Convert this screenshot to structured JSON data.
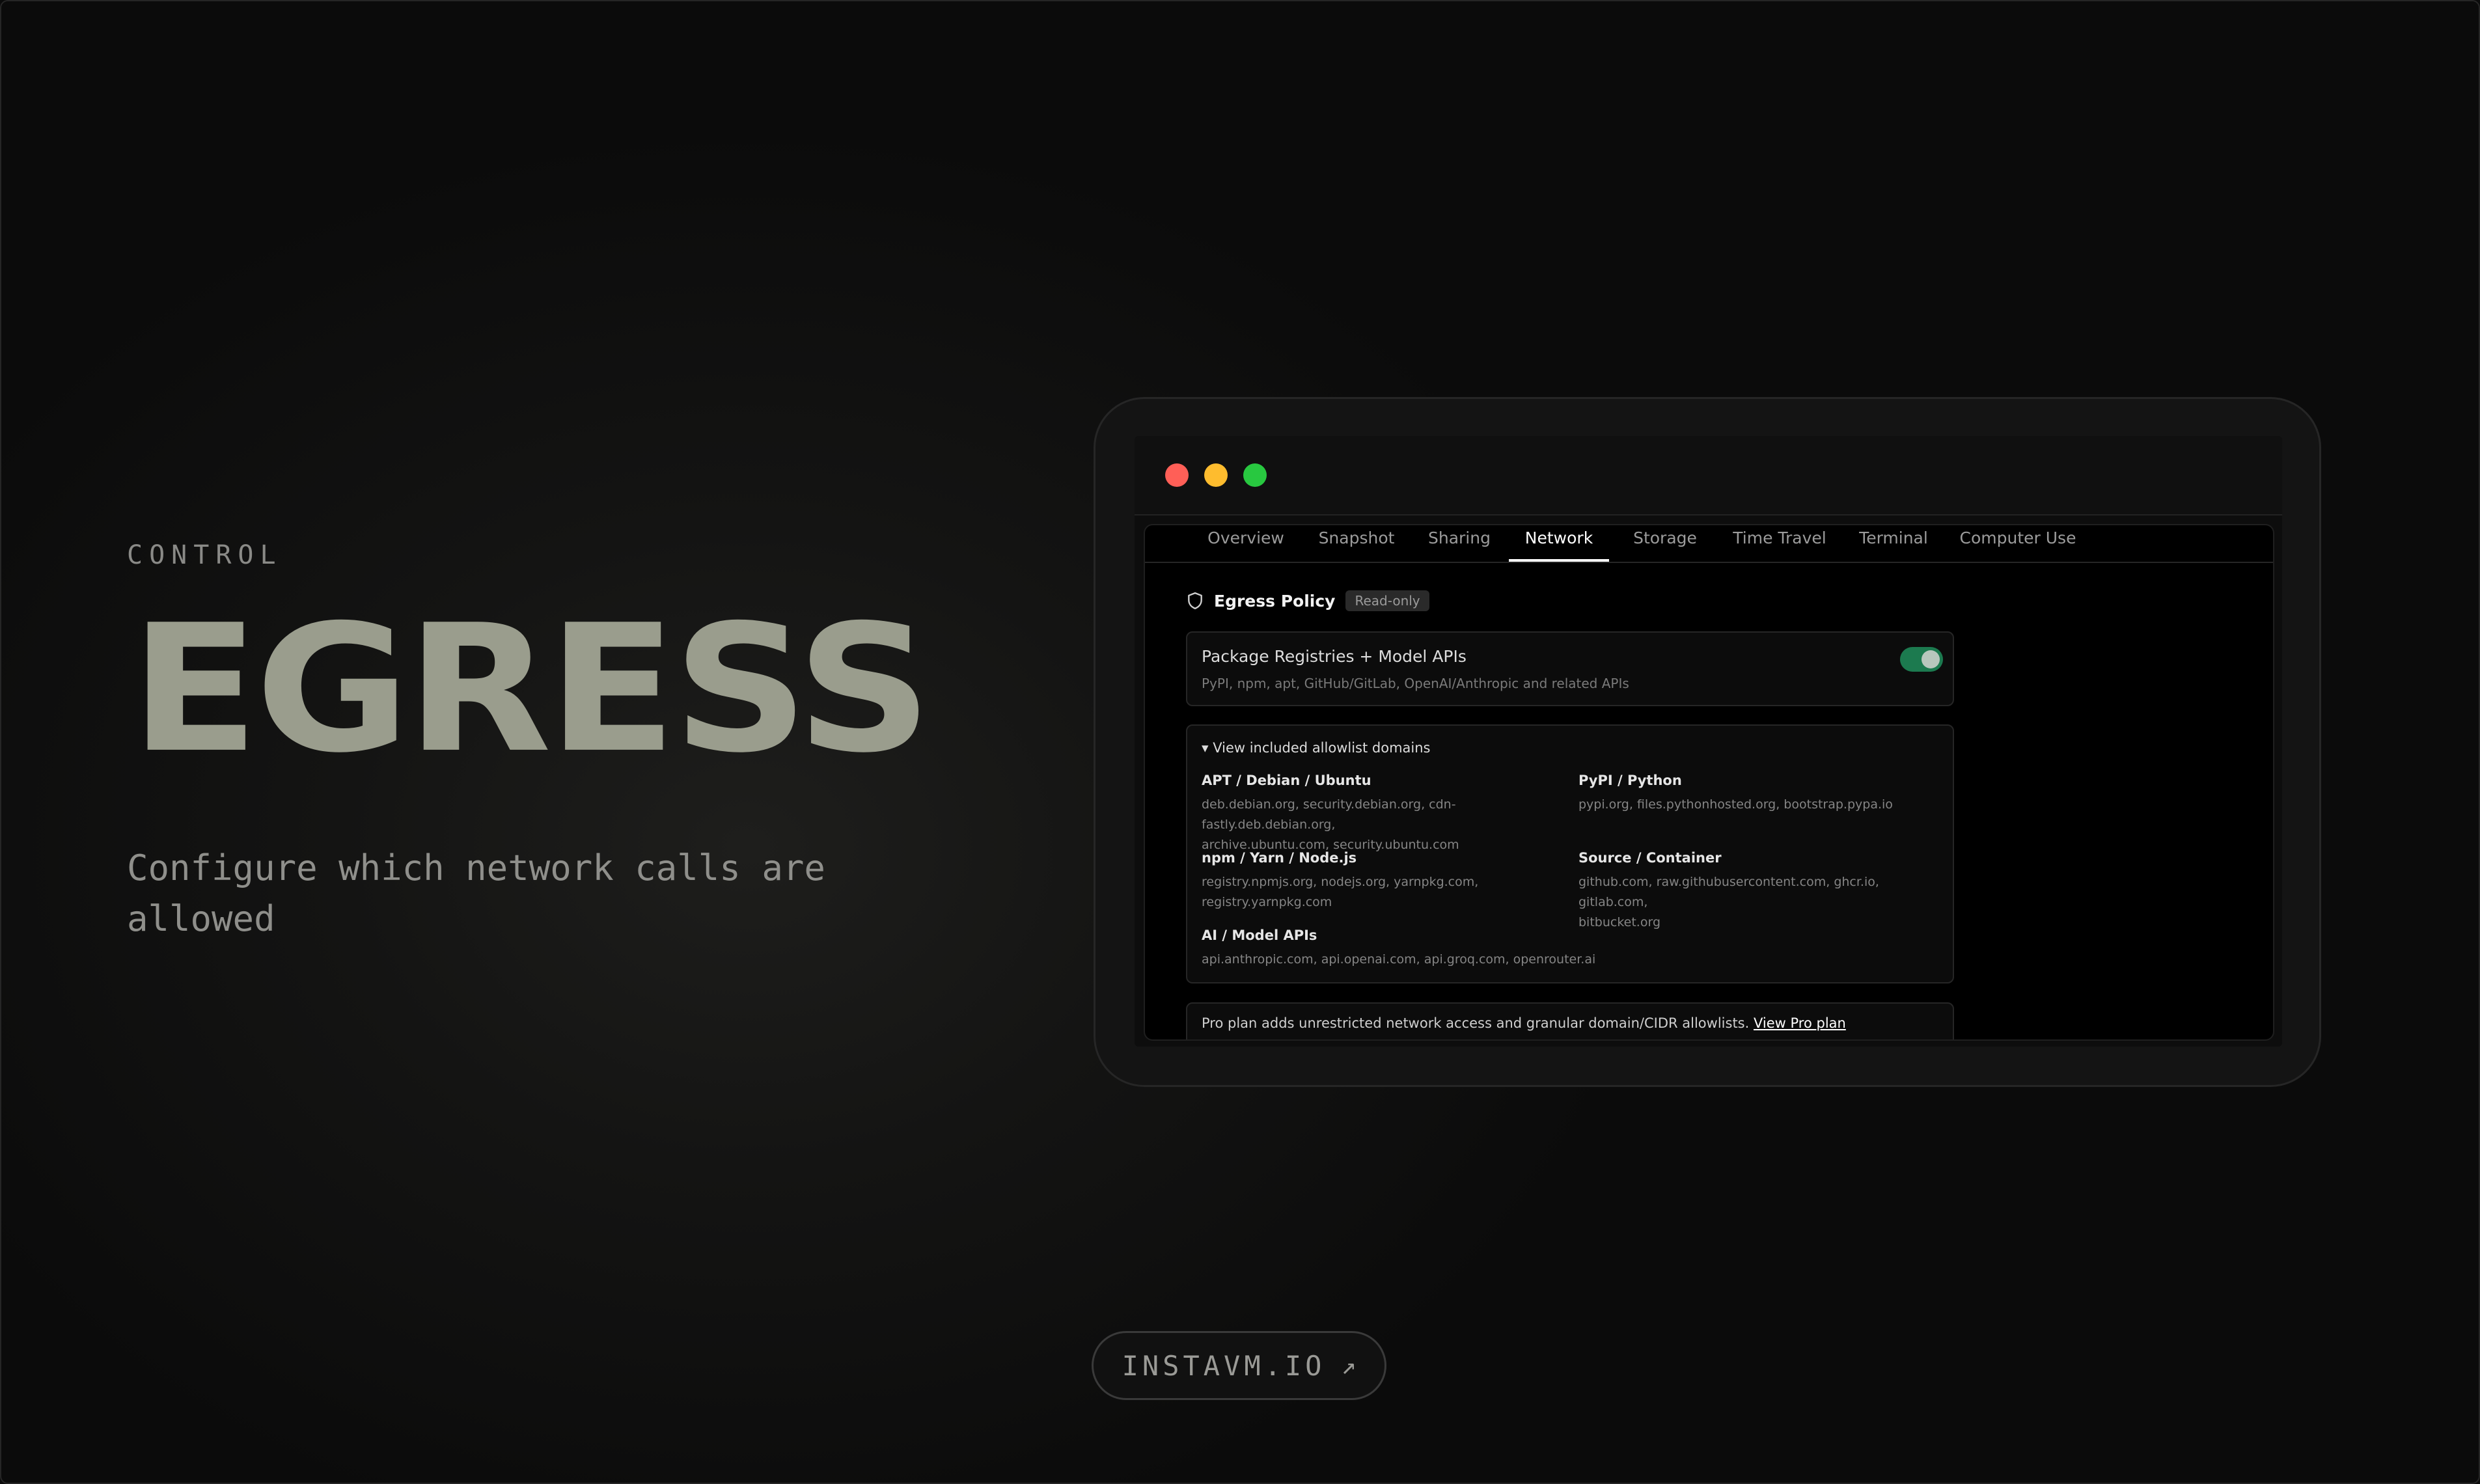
{
  "hero": {
    "eyebrow": "CONTROL",
    "title": "EGRESS",
    "subtitle": "Configure which network calls are allowed"
  },
  "cta": {
    "label": "INSTAVM.IO",
    "arrow": "↗"
  },
  "window": {
    "tabs": [
      {
        "label": "Overview"
      },
      {
        "label": "Snapshot"
      },
      {
        "label": "Sharing"
      },
      {
        "label": "Network",
        "active": true
      },
      {
        "label": "Storage"
      },
      {
        "label": "Time Travel"
      },
      {
        "label": "Terminal"
      },
      {
        "label": "Computer Use"
      }
    ],
    "policy": {
      "icon": "shield-icon",
      "title": "Egress Policy",
      "badge": "Read-only"
    },
    "preset": {
      "title": "Package Registries + Model APIs",
      "description": "PyPI, npm, apt, GitHub/GitLab, OpenAI/Anthropic and related APIs",
      "enabled": true
    },
    "allowlist": {
      "summary": "▾ View included allowlist domains",
      "groups": [
        {
          "title": "APT / Debian / Ubuntu",
          "domains": "deb.debian.org, security.debian.org, cdn-fastly.deb.debian.org,",
          "domains_2": "archive.ubuntu.com, security.ubuntu.com"
        },
        {
          "title": "PyPI / Python",
          "domains": "pypi.org, files.pythonhosted.org, bootstrap.pypa.io",
          "domains_2": ""
        },
        {
          "title": "npm / Yarn / Node.js",
          "domains": "registry.npmjs.org, nodejs.org, yarnpkg.com,",
          "domains_2": "registry.yarnpkg.com"
        },
        {
          "title": "Source / Container",
          "domains": "github.com, raw.githubusercontent.com, ghcr.io, gitlab.com,",
          "domains_2": "bitbucket.org"
        },
        {
          "title": "AI / Model APIs",
          "domains": "api.anthropic.com, api.openai.com, api.groq.com, openrouter.ai",
          "domains_2": ""
        }
      ]
    },
    "pro": {
      "text": "Pro plan adds unrestricted network access and granular domain/CIDR allowlists.",
      "link": "View Pro plan"
    }
  },
  "colors": {
    "accent_title": "#9a9d8d",
    "toggle_on": "#1c7a4f",
    "dot_red": "#ff5f57",
    "dot_yellow": "#febc2e",
    "dot_green": "#28c840"
  }
}
